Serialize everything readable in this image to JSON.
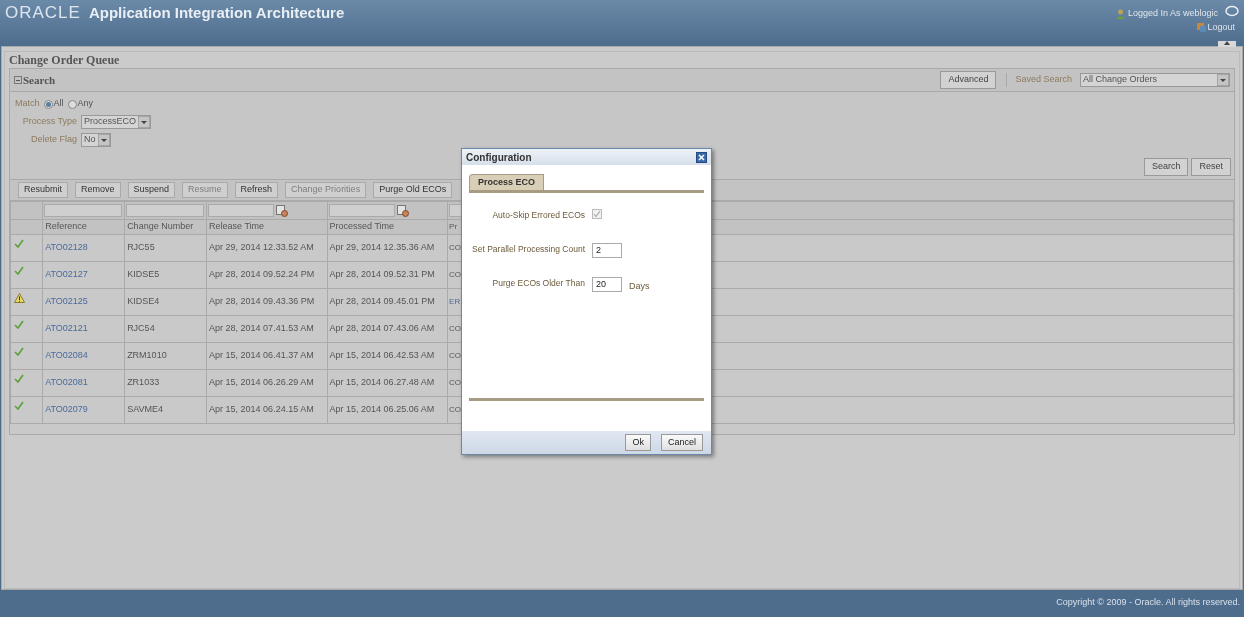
{
  "header": {
    "logo": "ORACLE",
    "title": "Application Integration Architecture",
    "user": "Logged In As weblogic",
    "logout": "Logout"
  },
  "page": {
    "title": "Change Order Queue"
  },
  "search": {
    "title": "Search",
    "expanded": true,
    "advanced_button": "Advanced",
    "saved_search_label": "Saved Search",
    "saved_search_value": "All Change Orders",
    "match_label": "Match",
    "match_options": [
      {
        "label": "All",
        "selected": true
      },
      {
        "label": "Any",
        "selected": false
      }
    ],
    "fields": [
      {
        "label": "Process Type",
        "value": "ProcessECO"
      },
      {
        "label": "Delete Flag",
        "value": "No"
      }
    ],
    "buttons": [
      "Search",
      "Reset"
    ]
  },
  "toolbar": [
    {
      "label": "Resubmit",
      "disabled": false
    },
    {
      "label": "Remove",
      "disabled": false
    },
    {
      "label": "Suspend",
      "disabled": false
    },
    {
      "label": "Resume",
      "disabled": true
    },
    {
      "label": "Refresh",
      "disabled": false
    },
    {
      "label": "Change Priorities",
      "disabled": true
    },
    {
      "label": "Purge Old ECOs",
      "disabled": false
    }
  ],
  "table": {
    "columns": [
      "Reference",
      "Change Number",
      "Release Time",
      "Processed Time",
      "Pr"
    ],
    "rows": [
      {
        "kind": "success",
        "reference": "ATO02128",
        "change_number": "RJC55",
        "release_time": "Apr 29, 2014 12.33.52 AM",
        "processed_time": "Apr 29, 2014 12.35.36 AM",
        "column_5": "CO"
      },
      {
        "kind": "success",
        "reference": "ATO02127",
        "change_number": "KIDSE5",
        "release_time": "Apr 28, 2014 09.52.24 PM",
        "processed_time": "Apr 28, 2014 09.52.31 PM",
        "column_5": "CO"
      },
      {
        "kind": "warning",
        "reference": "ATO02125",
        "change_number": "KIDSE4",
        "release_time": "Apr 28, 2014 09.43.36 PM",
        "processed_time": "Apr 28, 2014 09.45.01 PM",
        "column_5": "ER"
      },
      {
        "kind": "success",
        "reference": "ATO02121",
        "change_number": "RJC54",
        "release_time": "Apr 28, 2014 07.41.53 AM",
        "processed_time": "Apr 28, 2014 07.43.06 AM",
        "column_5": "CO"
      },
      {
        "kind": "success",
        "reference": "ATO02084",
        "change_number": "ZRM1010",
        "release_time": "Apr 15, 2014 06.41.37 AM",
        "processed_time": "Apr 15, 2014 06.42.53 AM",
        "column_5": "CO"
      },
      {
        "kind": "success",
        "reference": "ATO02081",
        "change_number": "ZR1033",
        "release_time": "Apr 15, 2014 06.26.29 AM",
        "processed_time": "Apr 15, 2014 06.27.48 AM",
        "column_5": "CO"
      },
      {
        "kind": "success",
        "reference": "ATO02079",
        "change_number": "SAVME4",
        "release_time": "Apr 15, 2014 06.24.15 AM",
        "processed_time": "Apr 15, 2014 06.25.06 AM",
        "column_5": "CO"
      }
    ]
  },
  "dialog": {
    "title": "Configuration",
    "tabs": [
      {
        "label": "Process ECO",
        "selected": true
      }
    ],
    "fields": [
      {
        "kind": "checkbox",
        "label": "Auto-Skip Errored ECOs",
        "checked": true,
        "disabled": true
      },
      {
        "kind": "input",
        "label": "Set Parallel Processing Count",
        "value": "2"
      },
      {
        "kind": "input",
        "label": "Purge ECOs Older Than",
        "value": "20",
        "suffix": "Days"
      }
    ],
    "buttons": [
      "Ok",
      "Cancel"
    ]
  },
  "footer": "Copyright © 2009 - Oracle. All rights reserved."
}
